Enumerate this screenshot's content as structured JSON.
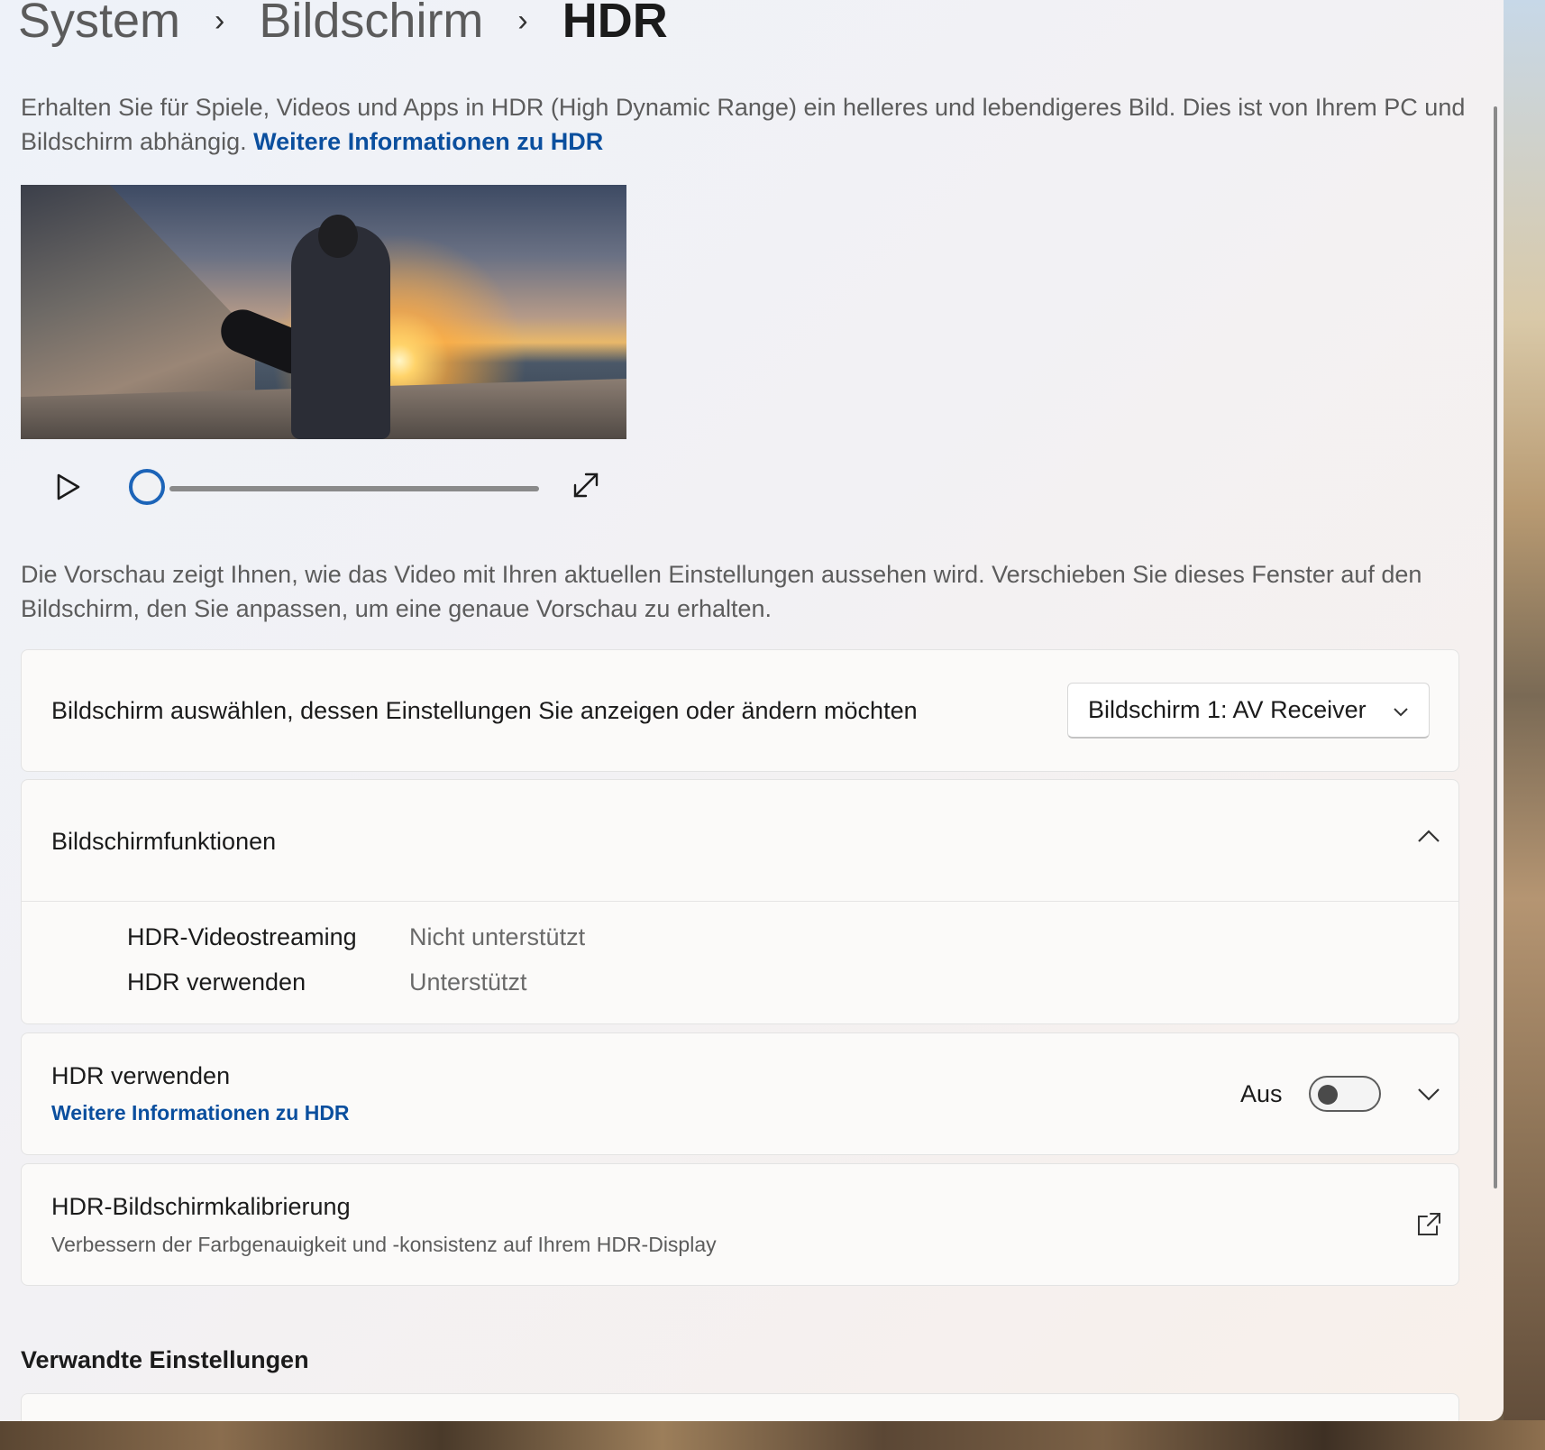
{
  "breadcrumb": {
    "items": [
      "System",
      "Bildschirm"
    ],
    "current": "HDR"
  },
  "intro": {
    "text": "Erhalten Sie für Spiele, Videos und Apps in HDR (High Dynamic Range) ein helleres und lebendigeres Bild. Dies ist von Ihrem PC und Bildschirm abhängig.",
    "link": "Weitere Informationen zu HDR"
  },
  "video": {
    "progress": 0
  },
  "preview_note": "Die Vorschau zeigt Ihnen, wie das Video mit Ihren aktuellen Einstellungen aussehen wird. Verschieben Sie dieses Fenster auf den Bildschirm, den Sie anpassen, um eine genaue Vorschau zu erhalten.",
  "display_select": {
    "label": "Bildschirm auswählen, dessen Einstellungen Sie anzeigen oder ändern möchten",
    "selected": "Bildschirm 1: AV Receiver"
  },
  "capabilities": {
    "title": "Bildschirmfunktionen",
    "rows": [
      {
        "name": "HDR-Videostreaming",
        "value": "Nicht unterstützt"
      },
      {
        "name": "HDR verwenden",
        "value": "Unterstützt"
      }
    ]
  },
  "use_hdr": {
    "title": "HDR verwenden",
    "link": "Weitere Informationen zu HDR",
    "state_label": "Aus"
  },
  "calibration": {
    "title": "HDR-Bildschirmkalibrierung",
    "subtitle": "Verbessern der Farbgenauigkeit und -konsistenz auf Ihrem HDR-Display"
  },
  "related": {
    "title": "Verwandte Einstellungen"
  },
  "colors": {
    "accent": "#1c64b8",
    "link": "#0b4f9e"
  }
}
